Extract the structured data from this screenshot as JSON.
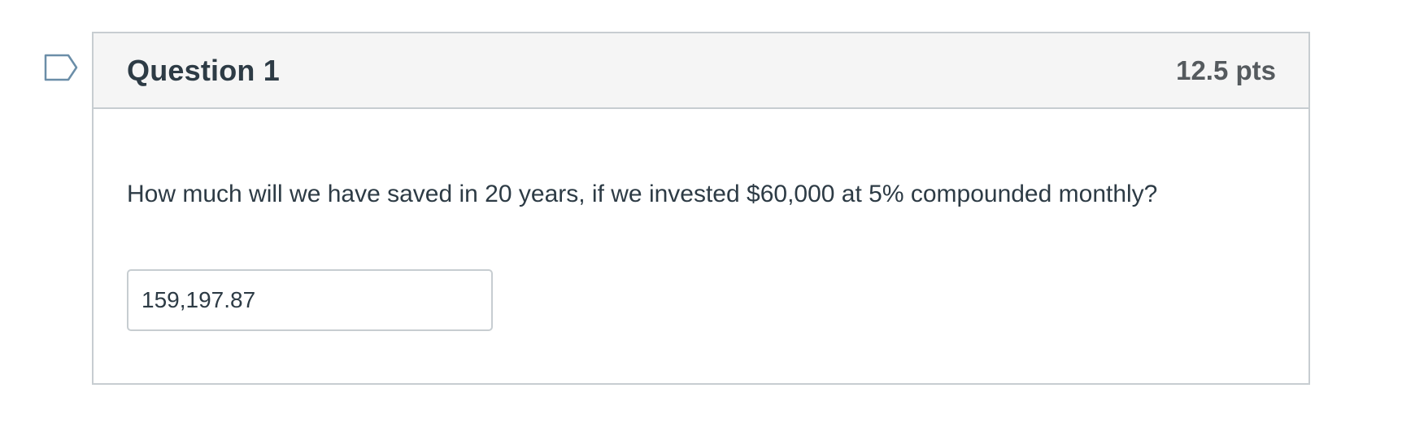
{
  "question": {
    "title": "Question 1",
    "points": "12.5 pts",
    "text": "How much will we have saved in 20 years, if we invested $60,000 at 5% compounded monthly?",
    "answer_value": "159,197.87"
  },
  "colors": {
    "border": "#c7cdd1",
    "header_bg": "#f5f5f5",
    "text": "#2d3b45",
    "points_text": "#555a5e",
    "flag_stroke": "#6b8ea8"
  },
  "icons": {
    "flag": "bookmark-flag-icon"
  }
}
